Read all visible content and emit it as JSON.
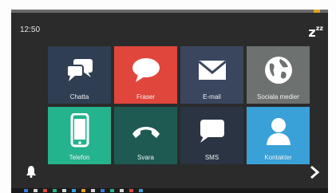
{
  "status": {
    "time": "12:50"
  },
  "tiles": [
    {
      "label": "Chatta",
      "icon": "chat-bubbles-icon"
    },
    {
      "label": "Fraser",
      "icon": "speech-bubble-icon"
    },
    {
      "label": "E-mail",
      "icon": "envelope-icon"
    },
    {
      "label": "Sociala medier",
      "icon": "globe-icon"
    },
    {
      "label": "Telefon",
      "icon": "smartphone-icon"
    },
    {
      "label": "Svara",
      "icon": "phone-handset-icon"
    },
    {
      "label": "SMS",
      "icon": "message-bubble-icon"
    },
    {
      "label": "Kontakter",
      "icon": "person-icon"
    }
  ],
  "colors": {
    "background": "#2b2b2b",
    "chatta": "#2f3e52",
    "fraser": "#e0463c",
    "email": "#3a465e",
    "sociala": "#6d7270",
    "telefon": "#24b38c",
    "svara": "#1e5a52",
    "sms": "#2a3442",
    "kontakter": "#3aa0d8"
  }
}
